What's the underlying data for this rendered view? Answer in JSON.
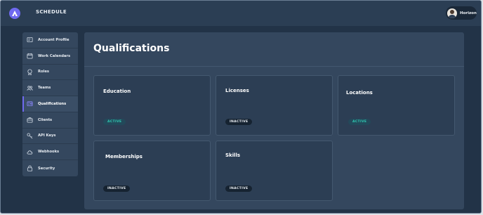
{
  "header": {
    "app_title": "SCHEDULE",
    "user_name": "Horizon"
  },
  "sidebar": {
    "items": [
      {
        "label": "Account Profile",
        "icon": "profile-icon"
      },
      {
        "label": "Work Calendars",
        "icon": "calendar-icon"
      },
      {
        "label": "Roles",
        "icon": "role-icon"
      },
      {
        "label": "Teams",
        "icon": "teams-icon"
      },
      {
        "label": "Qualifications",
        "icon": "qualifications-icon",
        "active": true
      },
      {
        "label": "Clients",
        "icon": "briefcase-icon"
      },
      {
        "label": "API Keys",
        "icon": "key-icon"
      },
      {
        "label": "Webhooks",
        "icon": "cloud-icon"
      },
      {
        "label": "Security",
        "icon": "lock-icon"
      }
    ]
  },
  "main": {
    "title": "Qualifications",
    "cards": [
      {
        "title": "Education",
        "status": "ACTIVE"
      },
      {
        "title": "Licenses",
        "status": "INACTIVE"
      },
      {
        "title": "Locations",
        "status": "ACTIVE"
      },
      {
        "title": "Memberships",
        "status": "INACTIVE"
      },
      {
        "title": "Skills",
        "status": "INACTIVE"
      }
    ]
  },
  "colors": {
    "accent": "#6f6af0",
    "active_badge_text": "#2fc9b2",
    "panel": "#34475e",
    "background": "#223347"
  }
}
